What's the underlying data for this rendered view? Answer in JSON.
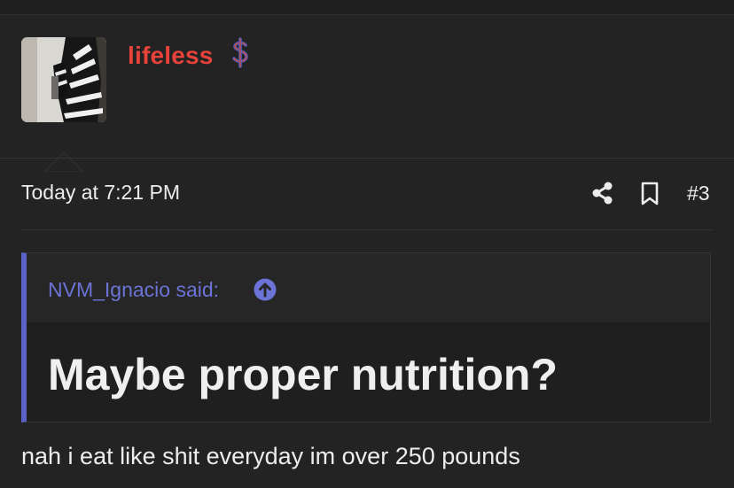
{
  "user": {
    "name": "lifeless",
    "avatar": "avatar",
    "name_color": "#e8433a",
    "badge_icon": "dollar-sign-icon"
  },
  "post": {
    "timestamp": "Today at 7:21 PM",
    "number": "#3",
    "share_icon": "share-icon",
    "bookmark_icon": "bookmark-icon"
  },
  "quote": {
    "author_label": "NVM_Ignacio said:",
    "jump_icon": "arrow-up-circle-icon",
    "text": "Maybe proper nutrition?",
    "accent_color": "#5b63c8"
  },
  "reply": {
    "text": "nah i eat like shit everyday im over 250 pounds"
  }
}
